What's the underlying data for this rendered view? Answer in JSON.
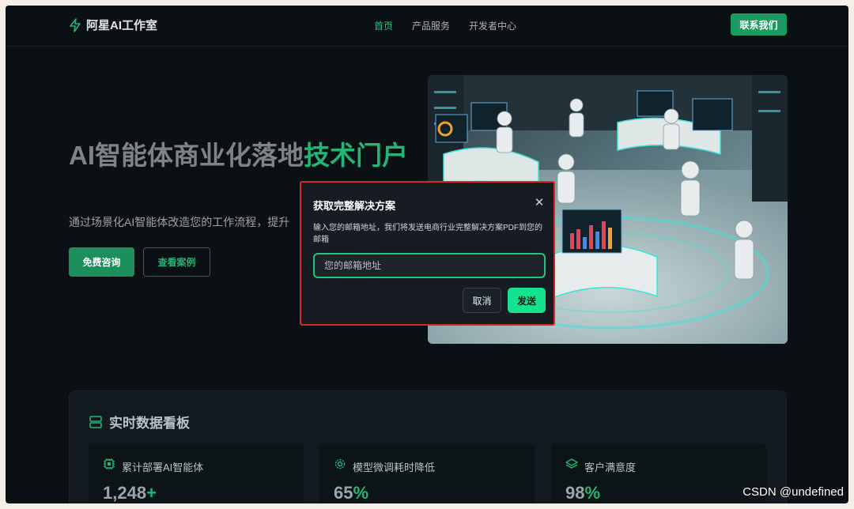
{
  "header": {
    "brand": "阿星AI工作室",
    "nav": [
      "首页",
      "产品服务",
      "开发者中心"
    ],
    "contact_label": "联系我们"
  },
  "hero": {
    "title_plain": "AI智能体商业化落地",
    "title_accent": "技术门户",
    "subtitle": "通过场景化AI智能体改造您的工作流程，提升",
    "primary_btn": "免费咨询",
    "secondary_btn": "查看案例"
  },
  "dashboard": {
    "title": "实时数据看板",
    "cards": [
      {
        "label": "累计部署AI智能体",
        "value": "1,248",
        "suffix": "+",
        "icon": "chip-icon"
      },
      {
        "label": "模型微调耗时降低",
        "value": "65",
        "suffix": "%",
        "icon": "gear-icon"
      },
      {
        "label": "客户满意度",
        "value": "98",
        "suffix": "%",
        "icon": "layers-icon"
      }
    ]
  },
  "modal": {
    "title": "获取完整解决方案",
    "description": "输入您的邮箱地址，我们将发送电商行业完整解决方案PDF到您的邮箱",
    "input_placeholder": "您的邮箱地址",
    "cancel": "取消",
    "send": "发送"
  },
  "watermark": "CSDN @undefined",
  "colors": {
    "accent": "#22b574",
    "send_button": "#15e28e",
    "background": "#0b1014",
    "modal_border": "#d32a2a"
  }
}
